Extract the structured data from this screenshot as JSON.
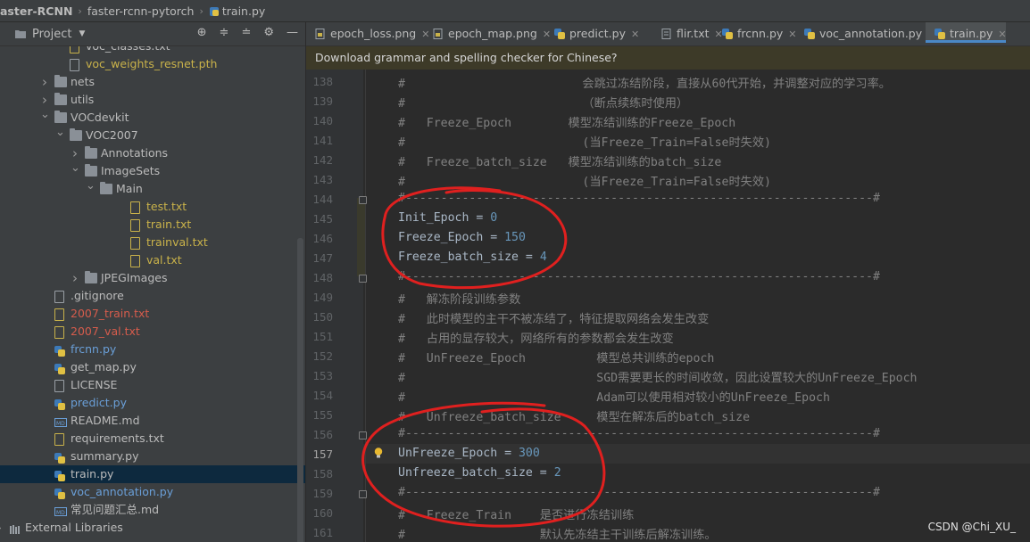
{
  "breadcrumb": {
    "items": [
      "aster-RCNN",
      "faster-rcnn-pytorch",
      "train.py"
    ]
  },
  "project_panel": {
    "title": "Project",
    "tree": [
      {
        "label": "voc_classes.txt",
        "type": "txt",
        "indent": 4,
        "color": "norm"
      },
      {
        "label": "voc_weights_resnet.pth",
        "type": "file",
        "indent": 4,
        "color": "yellow"
      },
      {
        "label": "nets",
        "type": "folder",
        "indent": 3,
        "arrow": "right",
        "color": "norm"
      },
      {
        "label": "utils",
        "type": "folder",
        "indent": 3,
        "arrow": "right",
        "color": "norm"
      },
      {
        "label": "VOCdevkit",
        "type": "folder",
        "indent": 3,
        "arrow": "down",
        "color": "norm"
      },
      {
        "label": "VOC2007",
        "type": "folder",
        "indent": 4,
        "arrow": "down",
        "color": "norm"
      },
      {
        "label": "Annotations",
        "type": "folder",
        "indent": 5,
        "arrow": "right",
        "color": "norm"
      },
      {
        "label": "ImageSets",
        "type": "folder",
        "indent": 5,
        "arrow": "down",
        "color": "norm"
      },
      {
        "label": "Main",
        "type": "folder",
        "indent": 6,
        "arrow": "down",
        "color": "norm"
      },
      {
        "label": "test.txt",
        "type": "txt",
        "indent": 8,
        "color": "yellow"
      },
      {
        "label": "train.txt",
        "type": "txt",
        "indent": 8,
        "color": "yellow"
      },
      {
        "label": "trainval.txt",
        "type": "txt",
        "indent": 8,
        "color": "yellow"
      },
      {
        "label": "val.txt",
        "type": "txt",
        "indent": 8,
        "color": "yellow"
      },
      {
        "label": "JPEGImages",
        "type": "folder",
        "indent": 5,
        "arrow": "right",
        "color": "norm"
      },
      {
        "label": ".gitignore",
        "type": "file",
        "indent": 3,
        "color": "norm"
      },
      {
        "label": "2007_train.txt",
        "type": "txt",
        "indent": 3,
        "color": "red"
      },
      {
        "label": "2007_val.txt",
        "type": "txt",
        "indent": 3,
        "color": "red"
      },
      {
        "label": "frcnn.py",
        "type": "py",
        "indent": 3,
        "color": "blue"
      },
      {
        "label": "get_map.py",
        "type": "py",
        "indent": 3,
        "color": "norm"
      },
      {
        "label": "LICENSE",
        "type": "file",
        "indent": 3,
        "color": "norm"
      },
      {
        "label": "predict.py",
        "type": "py",
        "indent": 3,
        "color": "blue"
      },
      {
        "label": "README.md",
        "type": "md",
        "indent": 3,
        "color": "norm"
      },
      {
        "label": "requirements.txt",
        "type": "txt",
        "indent": 3,
        "color": "norm"
      },
      {
        "label": "summary.py",
        "type": "py",
        "indent": 3,
        "color": "norm"
      },
      {
        "label": "train.py",
        "type": "py",
        "indent": 3,
        "color": "norm",
        "selected": true
      },
      {
        "label": "voc_annotation.py",
        "type": "py",
        "indent": 3,
        "color": "blue"
      },
      {
        "label": "常见问题汇总.md",
        "type": "md",
        "indent": 3,
        "color": "norm"
      },
      {
        "label": "External Libraries",
        "type": "lib",
        "indent": 0,
        "arrow": "right",
        "color": "norm"
      }
    ]
  },
  "tabs": [
    {
      "label": "epoch_loss.png",
      "icon": "image-file-icon"
    },
    {
      "label": "epoch_map.png",
      "icon": "image-file-icon"
    },
    {
      "label": "predict.py",
      "icon": "python-file-icon"
    },
    {
      "label": "flir.txt",
      "icon": "text-file-icon"
    },
    {
      "label": "frcnn.py",
      "icon": "python-file-icon"
    },
    {
      "label": "voc_annotation.py",
      "icon": "python-file-icon"
    },
    {
      "label": "train.py",
      "icon": "python-file-icon",
      "active": true
    }
  ],
  "notification": "Download grammar and spelling checker for Chinese?",
  "editor": {
    "current_line": 157,
    "lines": [
      {
        "n": 138,
        "text": "#                         会跳过冻结阶段，直接从60代开始，并调整对应的学习率。"
      },
      {
        "n": 139,
        "text": "#                         （断点续练时使用）"
      },
      {
        "n": 140,
        "text": "#   Freeze_Epoch        模型冻结训练的Freeze_Epoch"
      },
      {
        "n": 141,
        "text": "#                         (当Freeze_Train=False时失效)"
      },
      {
        "n": 142,
        "text": "#   Freeze_batch_size   模型冻结训练的batch_size"
      },
      {
        "n": 143,
        "text": "#                         (当Freeze_Train=False时失效)"
      },
      {
        "n": 144,
        "text": "#------------------------------------------------------------------#"
      },
      {
        "n": 145,
        "code": {
          "name": "Init_Epoch",
          "value": "0"
        }
      },
      {
        "n": 146,
        "code": {
          "name": "Freeze_Epoch",
          "value": "150"
        }
      },
      {
        "n": 147,
        "code": {
          "name": "Freeze_batch_size",
          "value": "4"
        }
      },
      {
        "n": 148,
        "text": "#------------------------------------------------------------------#"
      },
      {
        "n": 149,
        "text": "#   解冻阶段训练参数"
      },
      {
        "n": 150,
        "text": "#   此时模型的主干不被冻结了，特征提取网络会发生改变"
      },
      {
        "n": 151,
        "text": "#   占用的显存较大，网络所有的参数都会发生改变"
      },
      {
        "n": 152,
        "text": "#   UnFreeze_Epoch          模型总共训练的epoch"
      },
      {
        "n": 153,
        "text": "#                           SGD需要更长的时间收敛，因此设置较大的UnFreeze_Epoch"
      },
      {
        "n": 154,
        "text": "#                           Adam可以使用相对较小的UnFreeze_Epoch"
      },
      {
        "n": 155,
        "text": "#   Unfreeze_batch_size     模型在解冻后的batch_size"
      },
      {
        "n": 156,
        "text": "#------------------------------------------------------------------#"
      },
      {
        "n": 157,
        "code": {
          "name": "UnFreeze_Epoch",
          "value": "300"
        }
      },
      {
        "n": 158,
        "code": {
          "name": "Unfreeze_batch_size",
          "value": "2"
        }
      },
      {
        "n": 159,
        "text": "#------------------------------------------------------------------#"
      },
      {
        "n": 160,
        "text": "#   Freeze_Train    是否进行冻结训练"
      },
      {
        "n": 161,
        "text": "#                   默认先冻结主干训练后解冻训练。"
      }
    ]
  },
  "watermark": "CSDN @Chi_XU_",
  "colors": {
    "accent": "#4a88c7",
    "annotation": "#e0201f"
  }
}
